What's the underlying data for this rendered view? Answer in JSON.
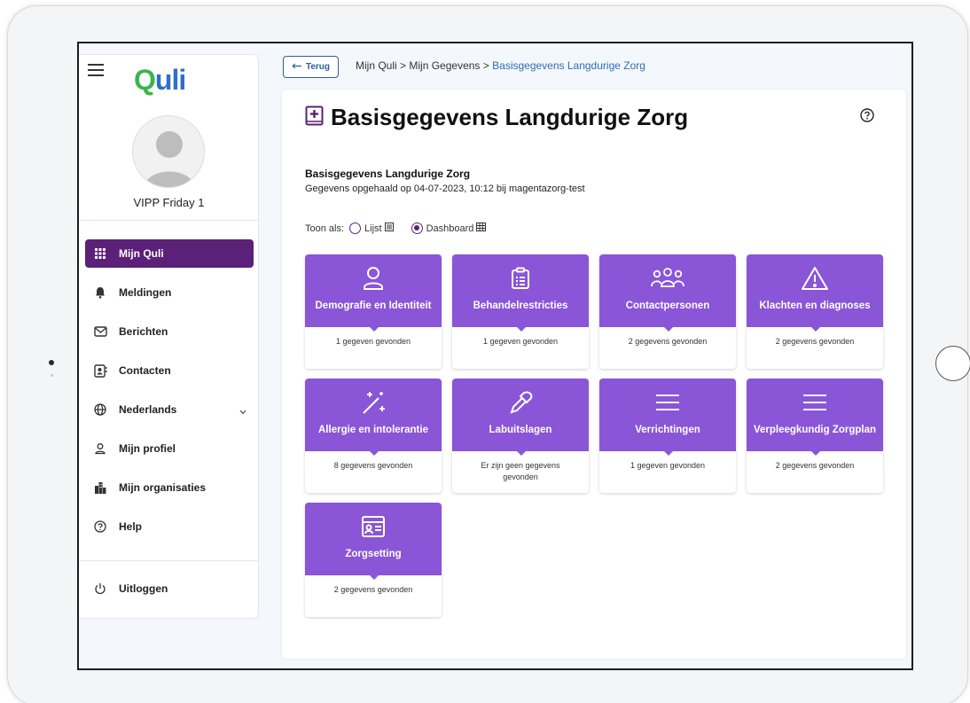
{
  "sidebar": {
    "logo": {
      "q": "Q",
      "rest": "uli"
    },
    "username": "VIPP Friday 1",
    "items": [
      {
        "label": "Mijn Quli",
        "icon": "grid-icon",
        "active": true
      },
      {
        "label": "Meldingen",
        "icon": "bell-icon"
      },
      {
        "label": "Berichten",
        "icon": "envelope-icon"
      },
      {
        "label": "Contacten",
        "icon": "contacts-icon"
      },
      {
        "label": "Nederlands",
        "icon": "globe-icon"
      },
      {
        "label": "Mijn profiel",
        "icon": "person-icon"
      },
      {
        "label": "Mijn organisaties",
        "icon": "building-icon"
      },
      {
        "label": "Help",
        "icon": "help-icon"
      }
    ],
    "logout": "Uitloggen"
  },
  "topbar": {
    "back_label": "Terug",
    "breadcrumb": [
      "Mijn Quli",
      "Mijn Gegevens",
      "Basisgegevens Langdurige Zorg"
    ],
    "separator": ">"
  },
  "content": {
    "title": "Basisgegevens Langdurige Zorg",
    "subtitle": "Basisgegevens Langdurige Zorg",
    "info": "Gegevens opgehaald op 04-07-2023, 10:12 bij magentazorg-test",
    "view_label": "Toon als:",
    "view_options": [
      {
        "label": "Lijst",
        "checked": false
      },
      {
        "label": "Dashboard",
        "checked": true
      }
    ],
    "tiles": [
      {
        "label": "Demografie en Identiteit",
        "count": "1 gegeven gevonden",
        "icon": "person-icon"
      },
      {
        "label": "Behandelrestricties",
        "count": "1 gegeven gevonden",
        "icon": "clipboard-icon"
      },
      {
        "label": "Contactpersonen",
        "count": "2 gegevens gevonden",
        "icon": "group-icon"
      },
      {
        "label": "Klachten en diagnoses",
        "count": "2 gegevens gevonden",
        "icon": "warning-icon"
      },
      {
        "label": "Allergie en intolerantie",
        "count": "8 gegevens gevonden",
        "icon": "magic-wand-icon"
      },
      {
        "label": "Labuitslagen",
        "count": "Er zijn geen gegevens gevonden",
        "icon": "pipette-icon"
      },
      {
        "label": "Verrichtingen",
        "count": "1 gegeven gevonden",
        "icon": "menu-lines-icon"
      },
      {
        "label": "Verpleegkundig Zorgplan",
        "count": "2 gegevens gevonden",
        "icon": "menu-lines-icon"
      },
      {
        "label": "Zorgsetting",
        "count": "2 gegevens gevonden",
        "icon": "id-card-icon"
      }
    ]
  },
  "colors": {
    "accent": "#5b2178",
    "tile": "#8a55d6",
    "link": "#2f6db3"
  }
}
